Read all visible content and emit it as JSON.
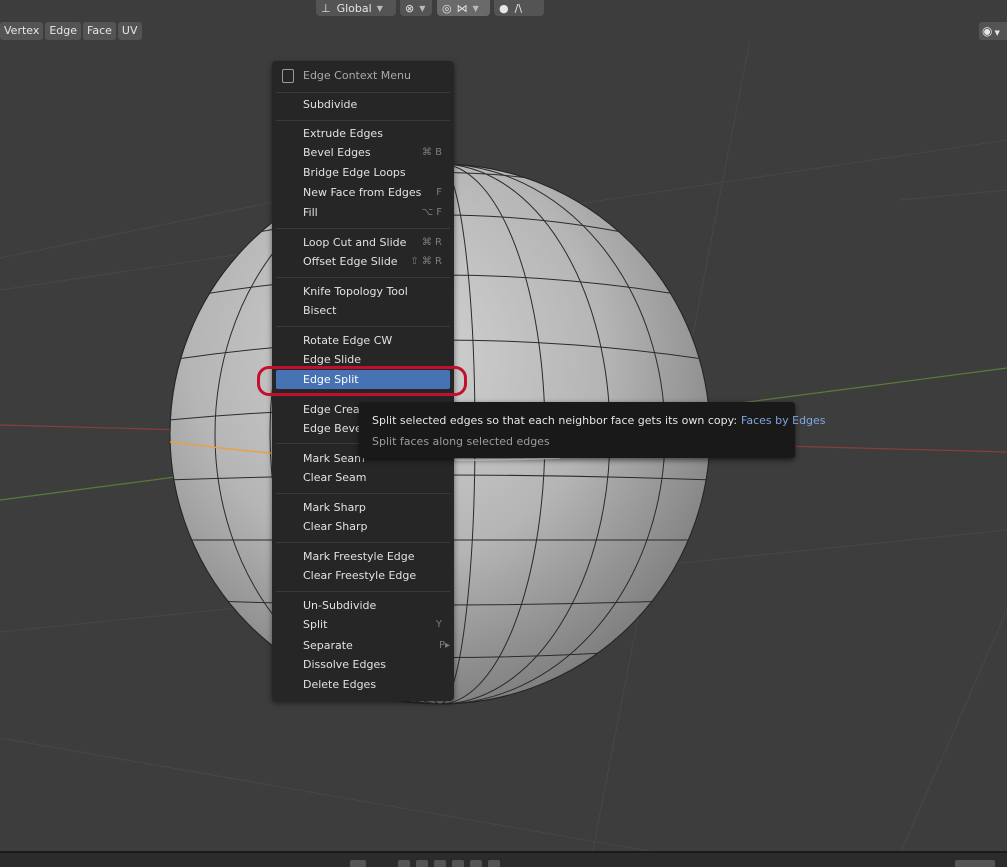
{
  "header": {
    "transform_orientation": "Global",
    "proportional_falloff_symbol": "/\\"
  },
  "mode_menus": [
    "Vertex",
    "Edge",
    "Face",
    "UV"
  ],
  "context_menu": {
    "title": "Edge Context Menu",
    "items": [
      {
        "label": "Subdivide",
        "shortcut": ""
      },
      {
        "label": "Extrude Edges",
        "shortcut": ""
      },
      {
        "label": "Bevel Edges",
        "shortcut": "⌘ B"
      },
      {
        "label": "Bridge Edge Loops",
        "shortcut": ""
      },
      {
        "label": "New Face from Edges",
        "shortcut": "F"
      },
      {
        "label": "Fill",
        "shortcut": "⌥ F"
      },
      {
        "label": "Loop Cut and Slide",
        "shortcut": "⌘ R"
      },
      {
        "label": "Offset Edge Slide",
        "shortcut": "⇧ ⌘ R"
      },
      {
        "label": "Knife Topology Tool",
        "shortcut": ""
      },
      {
        "label": "Bisect",
        "shortcut": ""
      },
      {
        "label": "Rotate Edge CW",
        "shortcut": ""
      },
      {
        "label": "Edge Slide",
        "shortcut": ""
      },
      {
        "label": "Edge Split",
        "shortcut": ""
      },
      {
        "label": "Edge Creas",
        "shortcut": ""
      },
      {
        "label": "Edge Bevel",
        "shortcut": ""
      },
      {
        "label": "Mark Seam",
        "shortcut": ""
      },
      {
        "label": "Clear Seam",
        "shortcut": ""
      },
      {
        "label": "Mark Sharp",
        "shortcut": ""
      },
      {
        "label": "Clear Sharp",
        "shortcut": ""
      },
      {
        "label": "Mark Freestyle Edge",
        "shortcut": ""
      },
      {
        "label": "Clear Freestyle Edge",
        "shortcut": ""
      },
      {
        "label": "Un-Subdivide",
        "shortcut": ""
      },
      {
        "label": "Split",
        "shortcut": "Y"
      },
      {
        "label": "Separate",
        "shortcut": "P▸"
      },
      {
        "label": "Dissolve Edges",
        "shortcut": ""
      },
      {
        "label": "Delete Edges",
        "shortcut": ""
      }
    ],
    "active_item": "Edge Split"
  },
  "tooltip": {
    "description": "Split selected edges so that each neighbor face gets its own copy:",
    "type": "Faces by Edges",
    "subtitle": "Split faces along selected edges"
  },
  "colors": {
    "viewport": "#3d3d3d",
    "menu_bg": "#262626",
    "active_item": "#4772b3",
    "highlight_ring": "#c0102d",
    "x_axis": "#8a3d3d",
    "y_axis": "#5a7a3a",
    "selected_edge": "#e8a048"
  }
}
